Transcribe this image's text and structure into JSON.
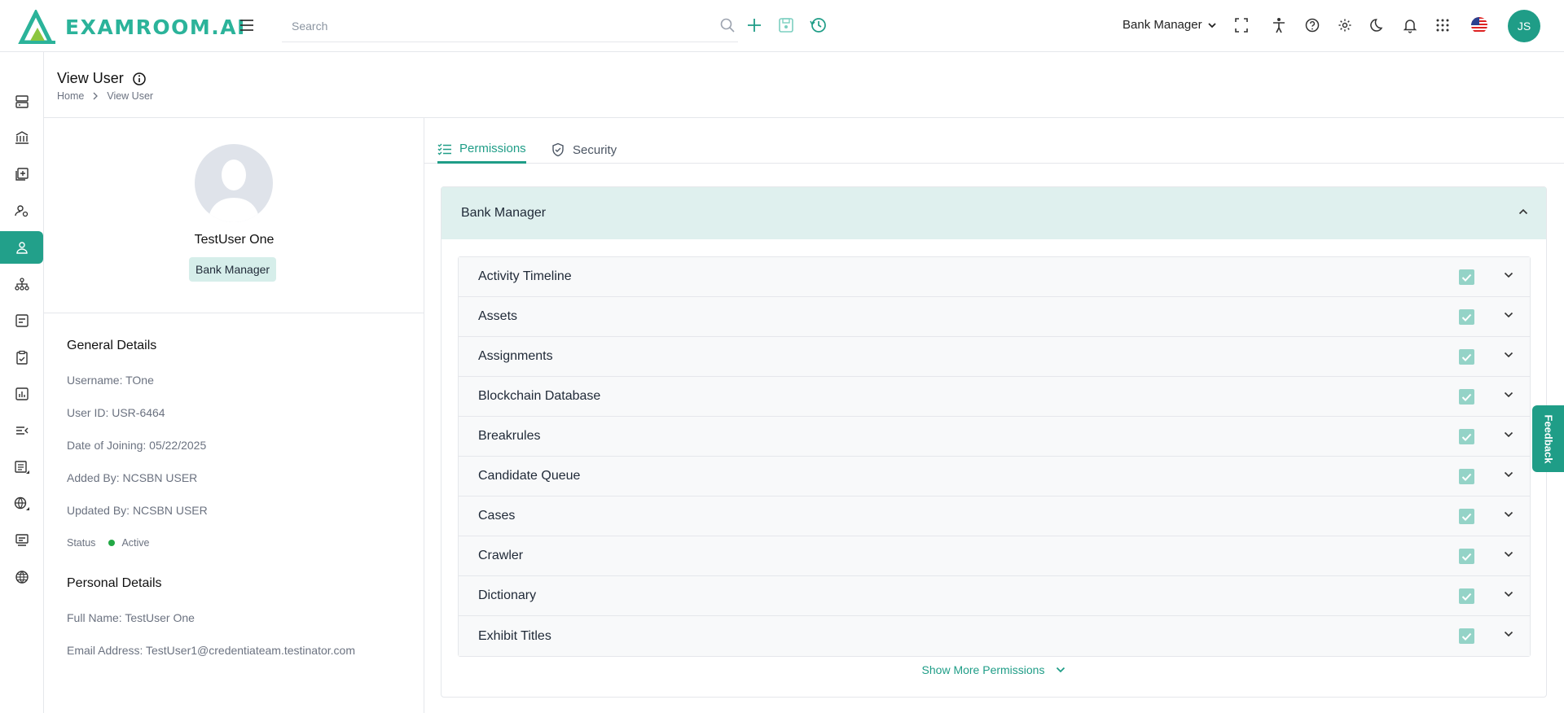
{
  "app": {
    "logo_text": "EXAMROOM.AI"
  },
  "topbar": {
    "search_placeholder": "Search",
    "role": "Bank Manager",
    "user_initials": "JS"
  },
  "page": {
    "title": "View User",
    "breadcrumb": [
      "Home",
      "View User"
    ]
  },
  "profile": {
    "name": "TestUser One",
    "role_badge": "Bank Manager",
    "general_title": "General Details",
    "username": "Username: TOne",
    "user_id": "User ID: USR-6464",
    "date_joining": "Date of Joining: 05/22/2025",
    "added_by": "Added By: NCSBN USER",
    "updated_by": "Updated By: NCSBN USER",
    "status_label": "Status",
    "status_value": "Active",
    "personal_title": "Personal Details",
    "full_name": "Full Name: TestUser One",
    "email": "Email Address: TestUser1@credentiateam.testinator.com"
  },
  "tabs": [
    {
      "label": "Permissions",
      "active": true
    },
    {
      "label": "Security",
      "active": false
    }
  ],
  "permissions": {
    "group_title": "Bank Manager",
    "items": [
      {
        "label": "Activity Timeline",
        "checked": true
      },
      {
        "label": "Assets",
        "checked": true
      },
      {
        "label": "Assignments",
        "checked": true
      },
      {
        "label": "Blockchain Database",
        "checked": true
      },
      {
        "label": "Breakrules",
        "checked": true
      },
      {
        "label": "Candidate Queue",
        "checked": true
      },
      {
        "label": "Cases",
        "checked": true
      },
      {
        "label": "Crawler",
        "checked": true
      },
      {
        "label": "Dictionary",
        "checked": true
      },
      {
        "label": "Exhibit Titles",
        "checked": true
      }
    ],
    "show_more": "Show More Permissions"
  },
  "feedback_label": "Feedback",
  "colors": {
    "accent": "#1f9d87",
    "accent_light": "#dff0ee",
    "check": "#94d3c7",
    "status_active": "#22a845"
  }
}
